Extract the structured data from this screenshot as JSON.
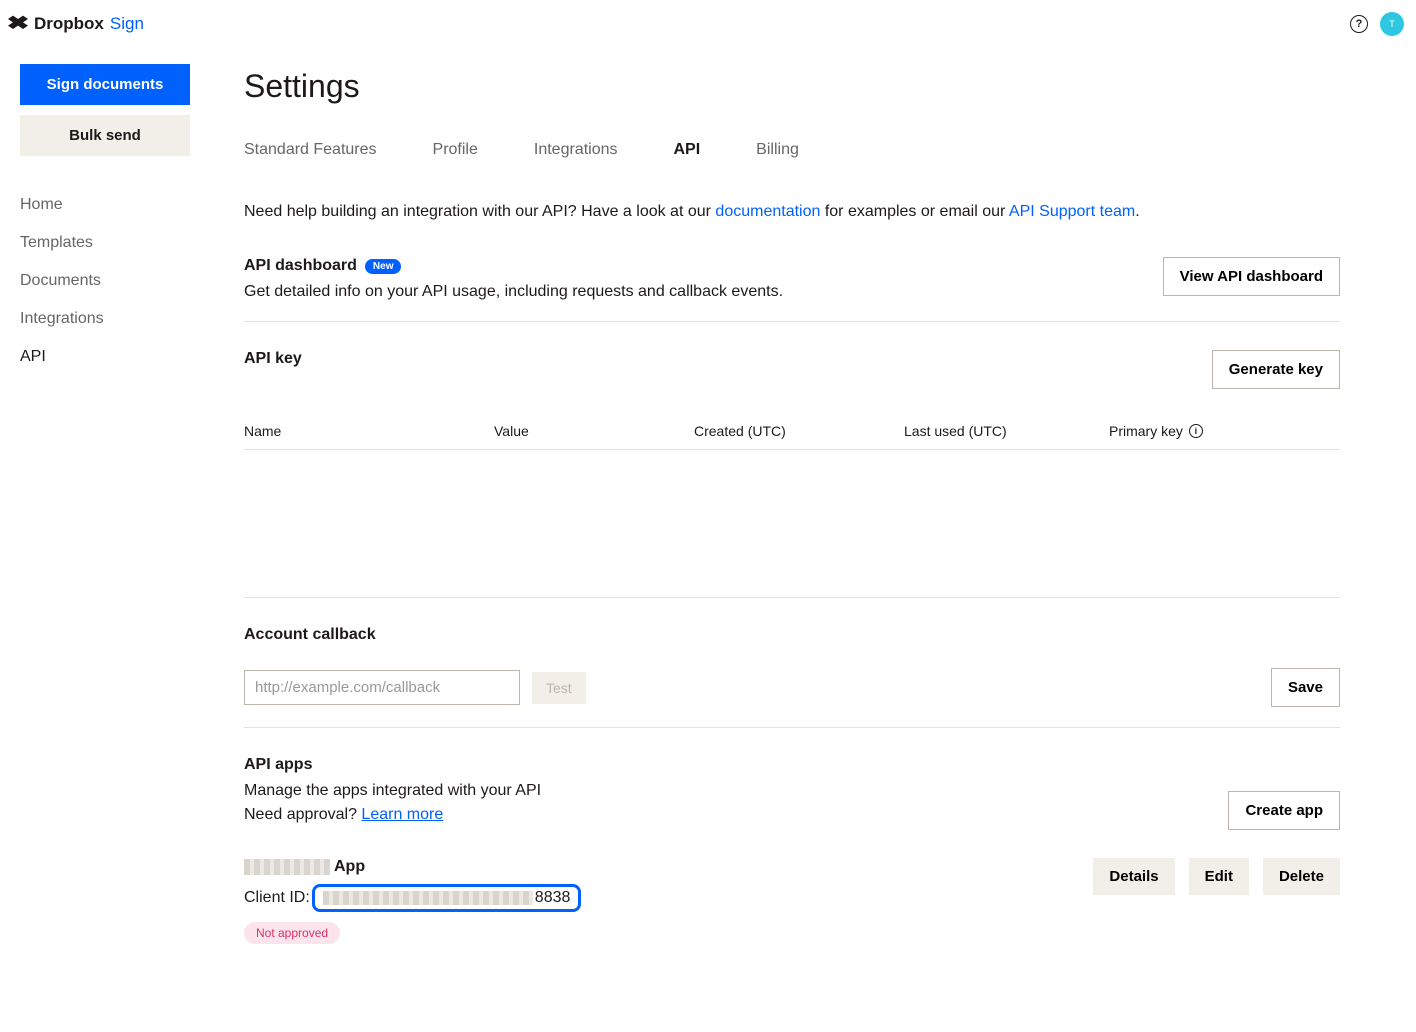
{
  "brand": {
    "name": "Dropbox",
    "product": "Sign",
    "avatar_initial": "T"
  },
  "sidebar": {
    "sign_documents": "Sign documents",
    "bulk_send": "Bulk send",
    "nav": [
      "Home",
      "Templates",
      "Documents",
      "Integrations",
      "API"
    ],
    "active_index": 4
  },
  "page_title": "Settings",
  "tabs": {
    "items": [
      "Standard Features",
      "Profile",
      "Integrations",
      "API",
      "Billing"
    ],
    "active_index": 3
  },
  "help": {
    "prefix": "Need help building an integration with our API? Have a look at our ",
    "doc_link": "documentation",
    "middle": " for examples or email our ",
    "support_link": "API Support team",
    "suffix": "."
  },
  "dashboard": {
    "title": "API dashboard",
    "badge": "New",
    "desc": "Get detailed info on your API usage, including requests and callback events.",
    "button": "View API dashboard"
  },
  "apikey": {
    "title": "API key",
    "button": "Generate key",
    "columns": {
      "name": "Name",
      "value": "Value",
      "created": "Created (UTC)",
      "lastused": "Last used (UTC)",
      "primary": "Primary key"
    }
  },
  "callback": {
    "title": "Account callback",
    "placeholder": "http://example.com/callback",
    "test": "Test",
    "save": "Save"
  },
  "apps": {
    "title": "API apps",
    "desc": "Manage the apps integrated with your API",
    "approval_prefix": "Need approval? ",
    "learn_more": "Learn more",
    "create": "Create app",
    "row": {
      "app_suffix": "App",
      "client_id_label": "Client ID:",
      "client_id_suffix": "8838",
      "status": "Not approved",
      "details": "Details",
      "edit": "Edit",
      "delete": "Delete"
    }
  }
}
